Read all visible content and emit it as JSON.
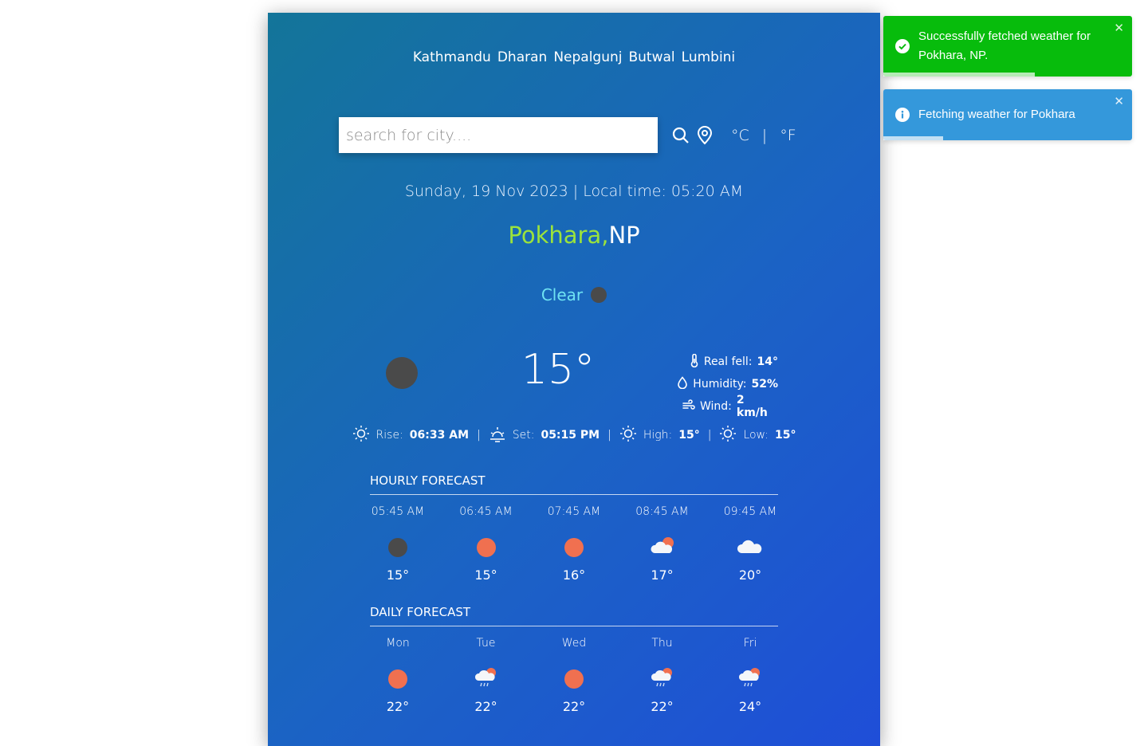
{
  "cities": [
    "Kathmandu",
    "Dharan",
    "Nepalgunj",
    "Butwal",
    "Lumbini"
  ],
  "search": {
    "placeholder": "search for city...."
  },
  "icons": {
    "search": "search-icon",
    "location": "location-pin-icon"
  },
  "units": {
    "celsius": "°C",
    "divider": "|",
    "fahrenheit": "°F"
  },
  "date_line": "Sunday, 19 Nov 2023 | Local time: 05:20 AM",
  "location": {
    "city": "Pokhara,",
    "country": "NP"
  },
  "condition": {
    "label": "Clear",
    "icon": "clear-night-icon"
  },
  "current": {
    "temp": "15°",
    "real_feel_label": "Real fell:",
    "real_feel": "14°",
    "humidity_label": "Humidity:",
    "humidity": "52%",
    "wind_label": "Wind:",
    "wind": "2 km/h"
  },
  "sun": {
    "rise_label": "Rise:",
    "rise": "06:33 AM",
    "set_label": "Set:",
    "set": "05:15 PM",
    "high_label": "High:",
    "high": "15°",
    "low_label": "Low:",
    "low": "15°",
    "sep": "|"
  },
  "hourly": {
    "title": "HOURLY FORECAST",
    "items": [
      {
        "time": "05:45 AM",
        "icon": "clear-night-icon",
        "temp": "15°"
      },
      {
        "time": "06:45 AM",
        "icon": "sun-icon",
        "temp": "15°"
      },
      {
        "time": "07:45 AM",
        "icon": "sun-icon",
        "temp": "16°"
      },
      {
        "time": "08:45 AM",
        "icon": "partly-cloudy-icon",
        "temp": "17°"
      },
      {
        "time": "09:45 AM",
        "icon": "cloud-icon",
        "temp": "20°"
      }
    ]
  },
  "daily": {
    "title": "DAILY FORECAST",
    "items": [
      {
        "day": "Mon",
        "icon": "sun-icon",
        "temp": "22°"
      },
      {
        "day": "Tue",
        "icon": "rain-sun-icon",
        "temp": "22°"
      },
      {
        "day": "Wed",
        "icon": "sun-icon",
        "temp": "22°"
      },
      {
        "day": "Thu",
        "icon": "rain-sun-icon",
        "temp": "22°"
      },
      {
        "day": "Fri",
        "icon": "rain-sun-icon",
        "temp": "24°"
      }
    ]
  },
  "toasts": [
    {
      "type": "success",
      "text": "Successfully fetched weather for Pokhara, NP.",
      "close": "✕",
      "progress": 0.61
    },
    {
      "type": "info",
      "text": "Fetching weather for Pokhara",
      "close": "✕",
      "progress": 0.24
    }
  ],
  "colors": {
    "success": "#07bc0c",
    "info": "#3498db",
    "city_accent": "#9be33c",
    "condition": "#6fe3f2"
  }
}
